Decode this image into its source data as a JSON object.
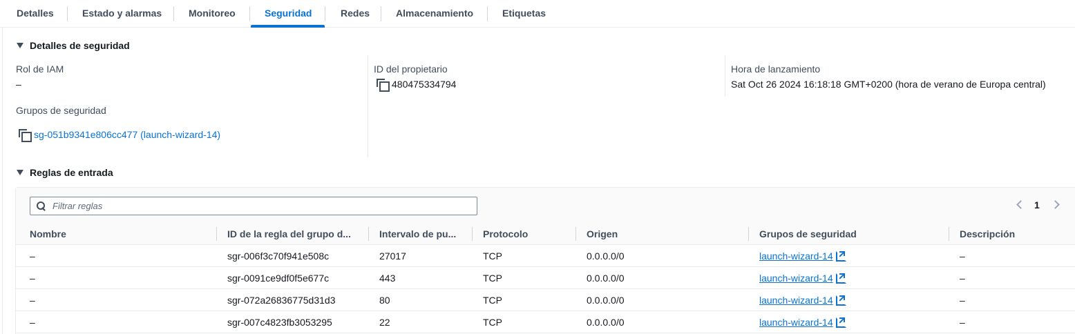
{
  "tabs": [
    {
      "label": "Detalles"
    },
    {
      "label": "Estado y alarmas"
    },
    {
      "label": "Monitoreo"
    },
    {
      "label": "Seguridad",
      "active": true
    },
    {
      "label": "Redes"
    },
    {
      "label": "Almacenamiento"
    },
    {
      "label": "Etiquetas"
    }
  ],
  "security_details": {
    "header": "Detalles de seguridad",
    "iam_role": {
      "label": "Rol de IAM",
      "value": "–"
    },
    "owner_id": {
      "label": "ID del propietario",
      "value": "480475334794",
      "icon": "copy-icon"
    },
    "launch_time": {
      "label": "Hora de lanzamiento",
      "value": "Sat Oct 26 2024 16:18:18 GMT+0200 (hora de verano de Europa central)"
    },
    "security_groups": {
      "label": "Grupos de seguridad",
      "value": "sg-051b9341e806cc477 (launch-wizard-14)",
      "icon": "copy-icon"
    }
  },
  "inbound_rules": {
    "header": "Reglas de entrada",
    "filter_placeholder": "Filtrar reglas",
    "page": "1",
    "columns": [
      "Nombre",
      "ID de la regla del grupo d...",
      "Intervalo de pu...",
      "Protocolo",
      "Origen",
      "Grupos de seguridad",
      "Descripción"
    ],
    "rows": [
      {
        "name": "–",
        "rule_id": "sgr-006f3c70f941e508c",
        "port_range": "27017",
        "protocol": "TCP",
        "source": "0.0.0.0/0",
        "security_group": "launch-wizard-14",
        "description": "–"
      },
      {
        "name": "–",
        "rule_id": "sgr-0091ce9df0f5e677c",
        "port_range": "443",
        "protocol": "TCP",
        "source": "0.0.0.0/0",
        "security_group": "launch-wizard-14",
        "description": "–"
      },
      {
        "name": "–",
        "rule_id": "sgr-072a26836775d31d3",
        "port_range": "80",
        "protocol": "TCP",
        "source": "0.0.0.0/0",
        "security_group": "launch-wizard-14",
        "description": "–"
      },
      {
        "name": "–",
        "rule_id": "sgr-007c4823fb3053295",
        "port_range": "22",
        "protocol": "TCP",
        "source": "0.0.0.0/0",
        "security_group": "launch-wizard-14",
        "description": "–"
      }
    ]
  },
  "colors": {
    "accent": "#0972d3",
    "text": "#16191f",
    "muted": "#414d5c",
    "border": "#e9ebed"
  }
}
